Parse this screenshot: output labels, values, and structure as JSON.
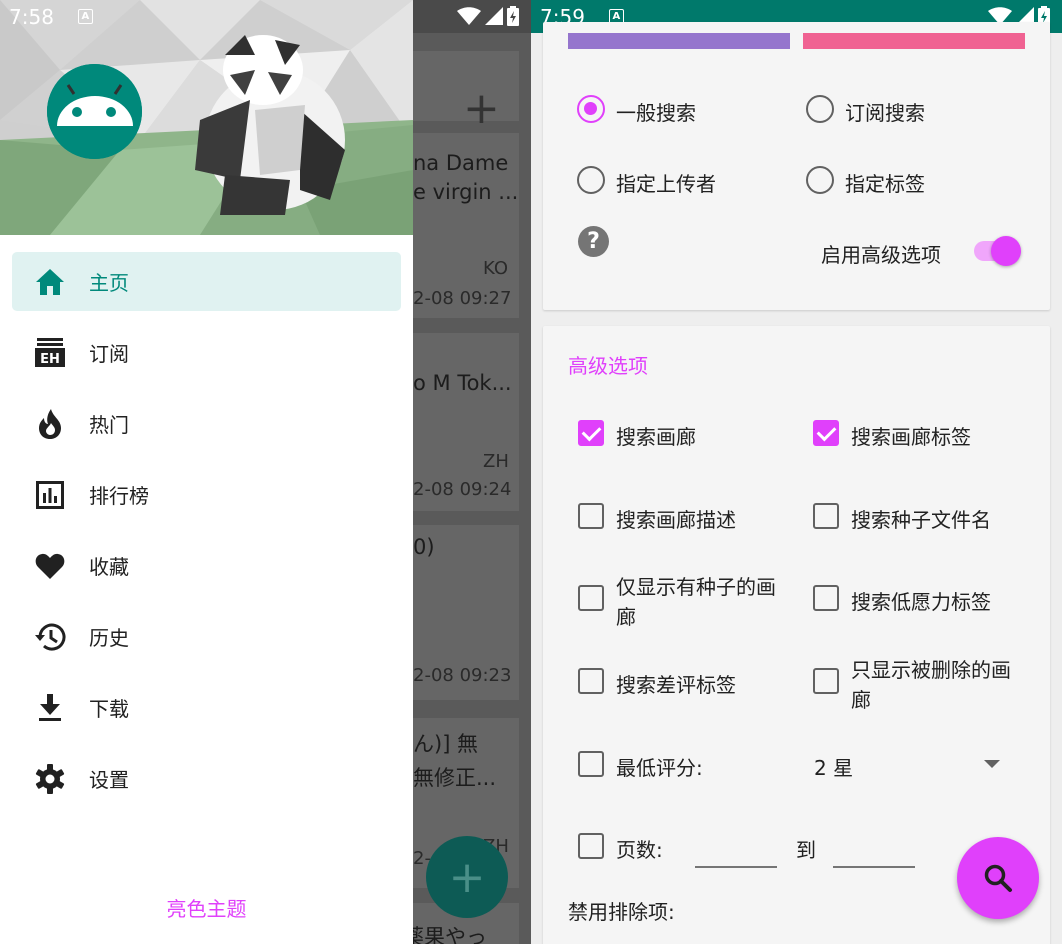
{
  "left_screen": {
    "status": {
      "time": "7:58",
      "a_badge": "A"
    },
    "drawer": {
      "nav_items": [
        {
          "label": "主页",
          "icon": "home-icon",
          "active": true
        },
        {
          "label": "订阅",
          "icon": "eh-subscription-icon",
          "active": false
        },
        {
          "label": "热门",
          "icon": "fire-icon",
          "active": false
        },
        {
          "label": "排行榜",
          "icon": "bar-chart-icon",
          "active": false
        },
        {
          "label": "收藏",
          "icon": "heart-icon",
          "active": false
        },
        {
          "label": "历史",
          "icon": "history-icon",
          "active": false
        },
        {
          "label": "下载",
          "icon": "download-icon",
          "active": false
        },
        {
          "label": "设置",
          "icon": "gear-icon",
          "active": false
        }
      ],
      "theme_button": "亮色主题"
    },
    "background_list": {
      "plus": "+",
      "items": [
        {
          "title1": "na Dame",
          "title2": "e virgin ...",
          "lang": "KO",
          "date": "2-08 09:27"
        },
        {
          "title1": "o M Tok...",
          "lang": "ZH",
          "date": "2-08 09:24"
        },
        {
          "title1": "0)",
          "date": "2-08 09:23"
        },
        {
          "title1": "ん)] 無",
          "title2": "無修正...",
          "lang": "ZH",
          "date": "2-"
        },
        {
          "title1": "薬果やっ"
        }
      ]
    }
  },
  "right_screen": {
    "status": {
      "time": "7:59",
      "a_badge": "A"
    },
    "colors": {
      "accent": "#e040fb",
      "teal": "#00796b",
      "bar_left": "#9575cd",
      "bar_right": "#f06292"
    },
    "search_mode": {
      "options": [
        "一般搜索",
        "订阅搜索",
        "指定上传者",
        "指定标签"
      ],
      "selected": "一般搜索",
      "help": "?",
      "advanced_toggle_label": "启用高级选项",
      "advanced_enabled": true
    },
    "advanced": {
      "title": "高级选项",
      "checkboxes": [
        {
          "label": "搜索画廊",
          "checked": true
        },
        {
          "label": "搜索画廊标签",
          "checked": true
        },
        {
          "label": "搜索画廊描述",
          "checked": false
        },
        {
          "label": "搜索种子文件名",
          "checked": false
        },
        {
          "label": "仅显示有种子的画",
          "label2": "廊",
          "checked": false
        },
        {
          "label": "搜索低愿力标签",
          "checked": false
        },
        {
          "label": "搜索差评标签",
          "checked": false
        },
        {
          "label": "只显示被删除的画",
          "label2": "廊",
          "checked": false
        }
      ],
      "min_rating_label": "最低评分:",
      "min_rating_value": "2 星",
      "pages_label": "页数:",
      "pages_to": "到",
      "pages_from_value": "",
      "pages_to_value": "",
      "disable_filters_label": "禁用排除项:"
    }
  }
}
